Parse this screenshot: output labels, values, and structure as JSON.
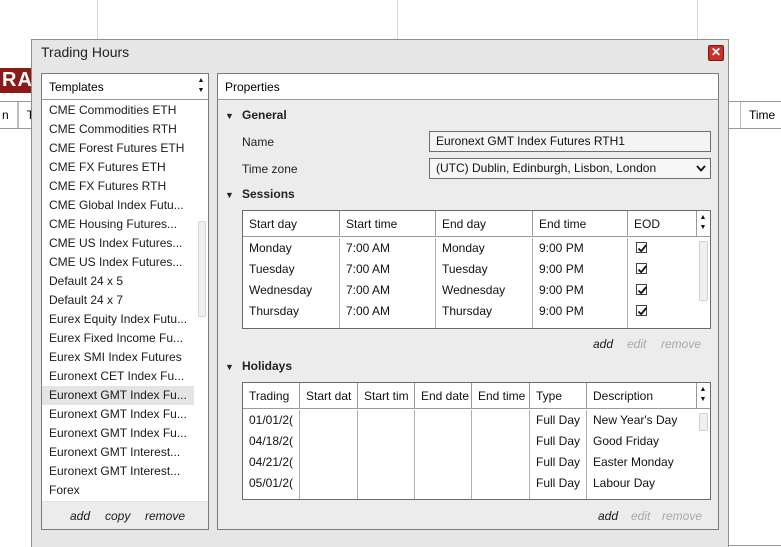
{
  "background": {
    "logo_text": "RA",
    "left_header_a": "n",
    "left_header_b": "Ty",
    "right_header": "Time"
  },
  "dialog": {
    "title": "Trading Hours",
    "close_icon": "close-icon",
    "close_glyph": "✕"
  },
  "templates": {
    "header": "Templates",
    "items": [
      "CME Commodities ETH",
      "CME Commodities RTH",
      "CME Forest Futures ETH",
      "CME FX Futures ETH",
      "CME FX Futures RTH",
      "CME Global Index Futu...",
      "CME Housing Futures...",
      "CME US Index Futures...",
      "CME US Index Futures...",
      "Default 24 x 5",
      "Default 24 x 7",
      "Eurex Equity Index Futu...",
      "Eurex Fixed Income Fu...",
      "Eurex SMI Index Futures",
      "Euronext CET Index Fu...",
      "Euronext GMT Index Fu...",
      "Euronext GMT Index Fu...",
      "Euronext GMT Index Fu...",
      "Euronext GMT Interest...",
      "Euronext GMT Interest...",
      "Forex"
    ],
    "selected_index": 15,
    "footer": {
      "add": "add",
      "copy": "copy",
      "remove": "remove"
    }
  },
  "properties": {
    "header": "Properties",
    "general": {
      "heading": "General",
      "name_label": "Name",
      "name_value": "Euronext GMT Index Futures RTH1",
      "timezone_label": "Time zone",
      "timezone_value": "(UTC) Dublin, Edinburgh, Lisbon, London"
    },
    "sessions": {
      "heading": "Sessions",
      "columns": [
        "Start day",
        "Start time",
        "End day",
        "End time",
        "EOD"
      ],
      "rows": [
        {
          "start_day": "Monday",
          "start_time": "7:00 AM",
          "end_day": "Monday",
          "end_time": "9:00 PM",
          "eod": true
        },
        {
          "start_day": "Tuesday",
          "start_time": "7:00 AM",
          "end_day": "Tuesday",
          "end_time": "9:00 PM",
          "eod": true
        },
        {
          "start_day": "Wednesday",
          "start_time": "7:00 AM",
          "end_day": "Wednesday",
          "end_time": "9:00 PM",
          "eod": true
        },
        {
          "start_day": "Thursday",
          "start_time": "7:00 AM",
          "end_day": "Thursday",
          "end_time": "9:00 PM",
          "eod": true
        }
      ],
      "actions": {
        "add": "add",
        "edit": "edit",
        "remove": "remove"
      }
    },
    "holidays": {
      "heading": "Holidays",
      "columns": [
        "Trading",
        "Start dat",
        "Start tim",
        "End date",
        "End time",
        "Type",
        "Description"
      ],
      "rows": [
        {
          "trading": "01/01/2(",
          "type": "Full Day",
          "description": "New Year's Day"
        },
        {
          "trading": "04/18/2(",
          "type": "Full Day",
          "description": "Good Friday"
        },
        {
          "trading": "04/21/2(",
          "type": "Full Day",
          "description": "Easter Monday"
        },
        {
          "trading": "05/01/2(",
          "type": "Full Day",
          "description": "Labour Day"
        }
      ],
      "actions": {
        "add": "add",
        "edit": "edit",
        "remove": "remove"
      }
    }
  }
}
